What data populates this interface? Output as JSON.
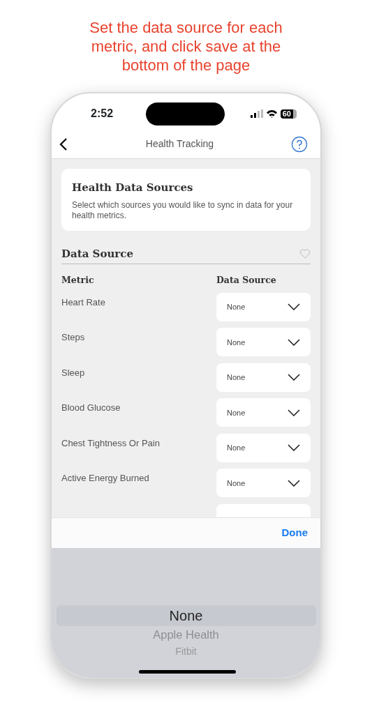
{
  "caption": "Set the data source for each metric, and click save at the bottom of the page",
  "status_bar": {
    "time": "2:52",
    "battery": "60"
  },
  "nav": {
    "title": "Health Tracking"
  },
  "intro_card": {
    "title": "Health Data Sources",
    "text": "Select which sources you would like to sync in data for your health metrics."
  },
  "section": {
    "title": "Data Source"
  },
  "table": {
    "columns": [
      "Metric",
      "Data Source"
    ],
    "rows": [
      {
        "metric": "Heart Rate",
        "source": "None"
      },
      {
        "metric": "Steps",
        "source": "None"
      },
      {
        "metric": "Sleep",
        "source": "None"
      },
      {
        "metric": "Blood Glucose",
        "source": "None"
      },
      {
        "metric": "Chest Tightness Or Pain",
        "source": "None"
      },
      {
        "metric": "Active Energy Burned",
        "source": "None"
      }
    ]
  },
  "toolbar": {
    "done": "Done"
  },
  "picker": {
    "options": [
      {
        "label": "None",
        "selected": true
      },
      {
        "label": "Apple Health",
        "selected": false
      },
      {
        "label": "Fitbit",
        "selected": false
      }
    ]
  }
}
